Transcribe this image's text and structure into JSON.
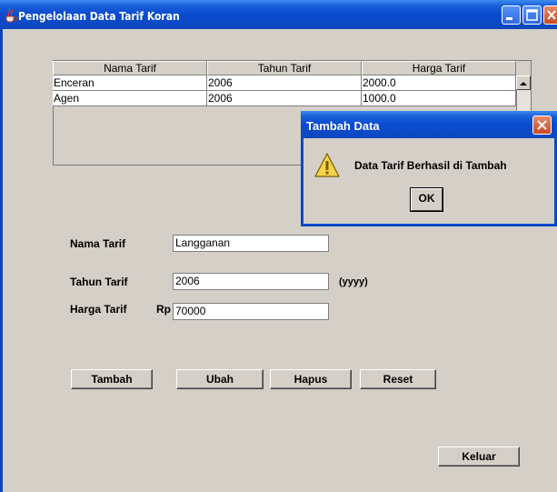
{
  "window": {
    "title": "Pengelolaan Data Tarif Koran"
  },
  "table": {
    "columns": [
      "Nama Tarif",
      "Tahun Tarif",
      "Harga Tarif"
    ],
    "rows": [
      [
        "Enceran",
        "2006",
        "2000.0"
      ],
      [
        "Agen",
        "2006",
        "1000.0"
      ]
    ]
  },
  "form": {
    "nama_tarif_label": "Nama Tarif",
    "nama_tarif_value": "Langganan",
    "tahun_tarif_label": "Tahun Tarif",
    "tahun_tarif_value": "2006",
    "tahun_hint": "(yyyy)",
    "harga_tarif_label": "Harga Tarif",
    "currency": "Rp",
    "harga_tarif_value": "70000"
  },
  "buttons": {
    "tambah": "Tambah",
    "ubah": "Ubah",
    "hapus": "Hapus",
    "reset": "Reset",
    "keluar": "Keluar"
  },
  "dialog": {
    "title": "Tambah Data",
    "message": "Data Tarif Berhasil di Tambah",
    "ok": "OK",
    "icon": "warning-icon"
  },
  "colors": {
    "titlebar": "#0b49c6",
    "panel": "#d4d0c8"
  }
}
